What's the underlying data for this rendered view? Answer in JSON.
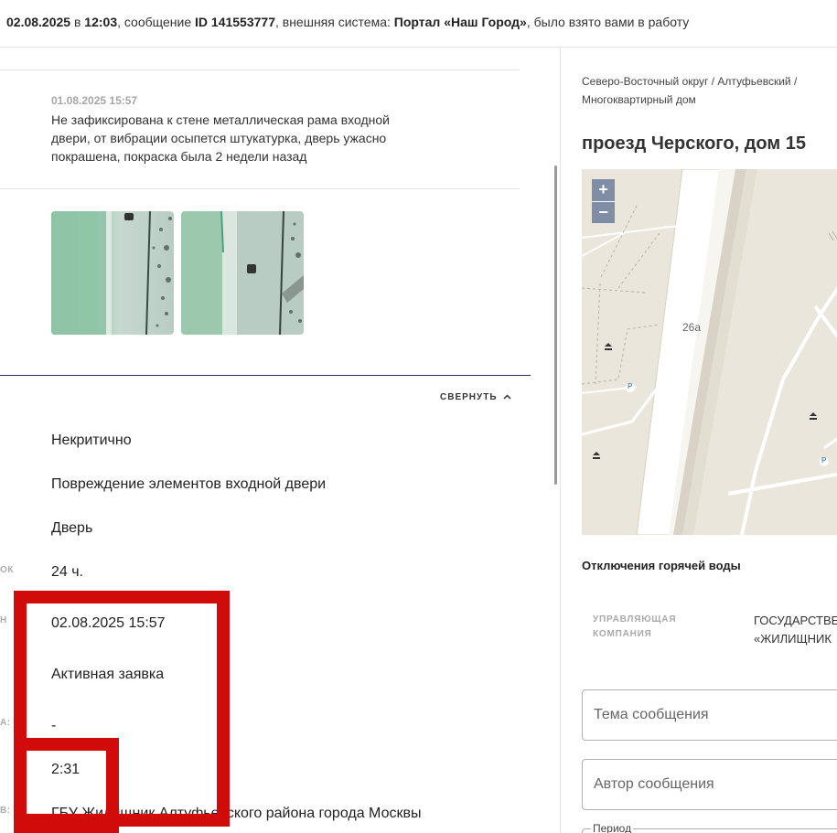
{
  "topbar": {
    "date": "02.08.2025",
    "in": " в ",
    "time": "12:03",
    "msg_prefix": ", сообщение ",
    "msg_id": "ID 141553777",
    "sys_prefix": ", внешняя система: ",
    "system": "Портал «Наш Город»",
    "suffix": ", было взято вами в работу"
  },
  "message": {
    "date": "01.08.2025 15:57",
    "text": "Не зафиксирована к стене металлическая рама входной двери, от вибрации осыпется штукатурка, дверь ужасно покрашена, покраска была 2 недели назад"
  },
  "details": {
    "collapse_label": "СВЕРНУТЬ",
    "collapse_icon": "chevron-up-icon",
    "criticality": "Некритично",
    "problem": "Повреждение элементов входной двери",
    "object": "Дверь",
    "deadline": "24 ч.",
    "date_due": "02.08.2025 15:57",
    "status": "Активная заявка",
    "dash": "-",
    "elapsed": "2:31",
    "organization": "ГБУ Жилищник Алтуфьевского района города Москвы"
  },
  "label_fragments": {
    "l1": "ОК",
    "l2": "Н",
    "l3": "А:",
    "l4": "В:"
  },
  "right": {
    "breadcrumb": "Северо-Восточный округ / Алтуфьевский / Многоквартирный дом",
    "address": "проезд Черского, дом 15",
    "map": {
      "zoom_in": "+",
      "zoom_out": "−",
      "building_label": "26а",
      "parking_label": "P"
    },
    "hot_water": "Отключения горячей воды",
    "uk_label": "УПРАВЛЯЮЩАЯ КОМПАНИЯ",
    "uk_value_1": "ГОСУДАРСТВЕ",
    "uk_value_2": "«ЖИЛИЩНИК",
    "topic_placeholder": "Тема сообщения",
    "author_placeholder": "Автор сообщения",
    "period_label": "Период"
  },
  "colors": {
    "accent_dark": "#2e2e5e",
    "highlight_red": "#d10a0a",
    "zoom_button": "#7f8ea6",
    "map_background": "#eae6dc"
  }
}
